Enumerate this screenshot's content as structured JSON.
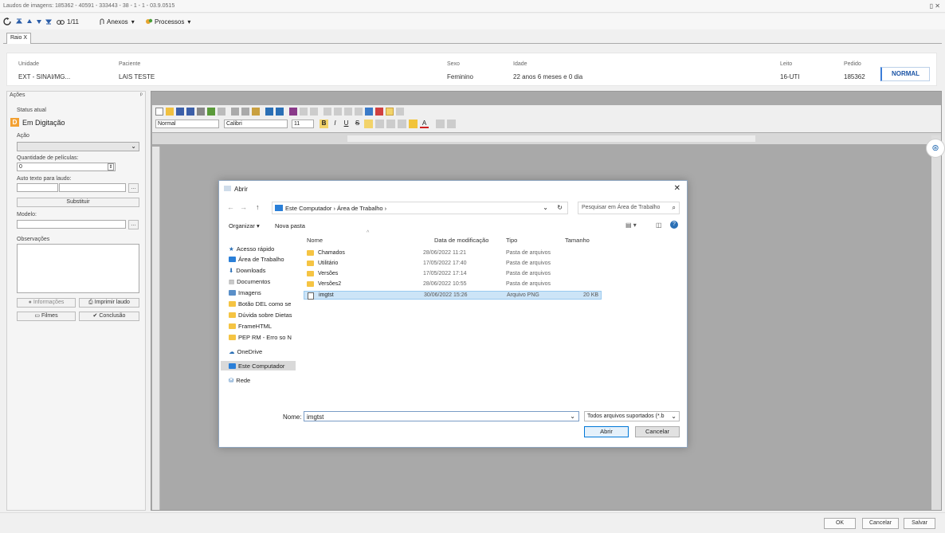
{
  "window": {
    "title": "Laudos de imagens: 185362 - 40591 - 333443 - 38 - 1 - 1 - 03.9.0515",
    "controls": "▯ ✕"
  },
  "toolbar": {
    "counter": "1/11",
    "anexos": "Anexos",
    "processos": "Processos"
  },
  "tab": "Raio X",
  "patient": {
    "unidade_label": "Unidade",
    "unidade": "EXT - SINAI/MG...",
    "paciente_label": "Paciente",
    "paciente": "LAIS TESTE",
    "sexo_label": "Sexo",
    "sexo": "Feminino",
    "idade_label": "Idade",
    "idade": "22 anos 6 meses e 0 dia",
    "leito_label": "Leito",
    "leito": "16-UTI",
    "pedido_label": "Pedido",
    "pedido": "185362",
    "prioridade": "NORMAL"
  },
  "left": {
    "header": "Ações",
    "status_label": "Status atual",
    "status_letter": "D",
    "status_text": "Em Digitação",
    "acao_label": "Ação",
    "peliculas_label": "Quantidade de películas:",
    "peliculas_value": "0",
    "auto_texto_label": "Auto texto para laudo:",
    "substituir": "Substituir",
    "modelo_label": "Modelo:",
    "observacoes_label": "Observações",
    "informacoes": "Informações",
    "imprimir": "Imprimir laudo",
    "filmes": "Filmes",
    "conclusao": "Conclusão"
  },
  "editor": {
    "style": "Normal",
    "font": "Calibri",
    "size": "11"
  },
  "dialog": {
    "title": "Abrir",
    "breadcrumb": "Este Computador  ›  Área de Trabalho  ›",
    "search_placeholder": "Pesquisar em Área de Trabalho",
    "organizar": "Organizar",
    "nova_pasta": "Nova pasta",
    "columns": {
      "name": "Nome",
      "date": "Data de modificação",
      "type": "Tipo",
      "size": "Tamanho"
    },
    "nav": [
      "Acesso rápido",
      "Área de Trabalho",
      "Downloads",
      "Documentos",
      "Imagens",
      "Botão DEL como se",
      "Dúvida sobre Dietas",
      "FrameHTML",
      "PEP RM - Erro so N",
      "OneDrive",
      "Este Computador",
      "Rede"
    ],
    "files": [
      {
        "name": "Chamados",
        "date": "28/06/2022 11:21",
        "type": "Pasta de arquivos",
        "size": ""
      },
      {
        "name": "Utilitário",
        "date": "17/05/2022 17:40",
        "type": "Pasta de arquivos",
        "size": ""
      },
      {
        "name": "Versões",
        "date": "17/05/2022 17:14",
        "type": "Pasta de arquivos",
        "size": ""
      },
      {
        "name": "Versões2",
        "date": "28/06/2022 10:55",
        "type": "Pasta de arquivos",
        "size": ""
      },
      {
        "name": "imgtst",
        "date": "30/06/2022 15:26",
        "type": "Arquivo PNG",
        "size": "20 KB"
      }
    ],
    "nome_label": "Nome:",
    "nome_value": "imgtst",
    "filter": "Todos arquivos suportados (*.b",
    "abrir": "Abrir",
    "cancelar": "Cancelar"
  },
  "bottom": {
    "ok": "OK",
    "cancelar": "Cancelar",
    "salvar": "Salvar"
  }
}
